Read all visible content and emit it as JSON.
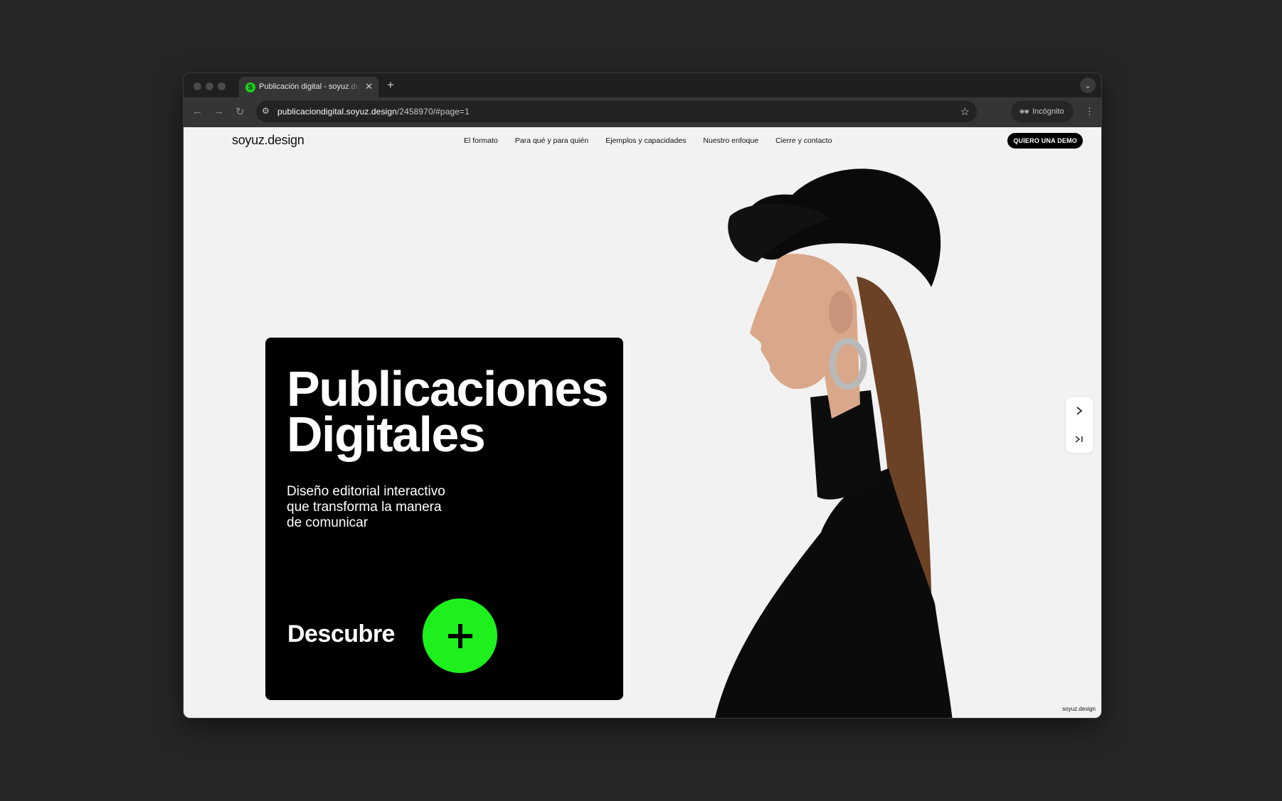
{
  "browser": {
    "tab_title": "Publicación digital - soyuz.design",
    "tab_favicon_letter": "S",
    "url_host": "publicaciondigital.soyuz.design",
    "url_path": "/2458970/#page=1",
    "incognito_label": "Incógnito",
    "accent": "#1ef01e"
  },
  "site": {
    "logo": "soyuz.design",
    "nav": [
      "El formato",
      "Para qué y para quién",
      "Ejemplos y capacidades",
      "Nuestro enfoque",
      "Cierre y contacto"
    ],
    "cta_button": "QUIERO UNA DEMO",
    "watermark": "soyuz.design"
  },
  "hero": {
    "title_line1": "Publicaciones",
    "title_line2": "Digitales",
    "subtitle_line1": "Diseño editorial interactivo",
    "subtitle_line2": "que transforma la manera",
    "subtitle_line3": "de comunicar",
    "cta_label": "Descubre"
  },
  "icons": {
    "back": "arrow-left-icon",
    "forward": "arrow-right-icon",
    "reload": "reload-icon",
    "star": "star-icon",
    "next": "chevron-right-icon",
    "last": "skip-to-end-icon",
    "plus": "plus-icon"
  }
}
